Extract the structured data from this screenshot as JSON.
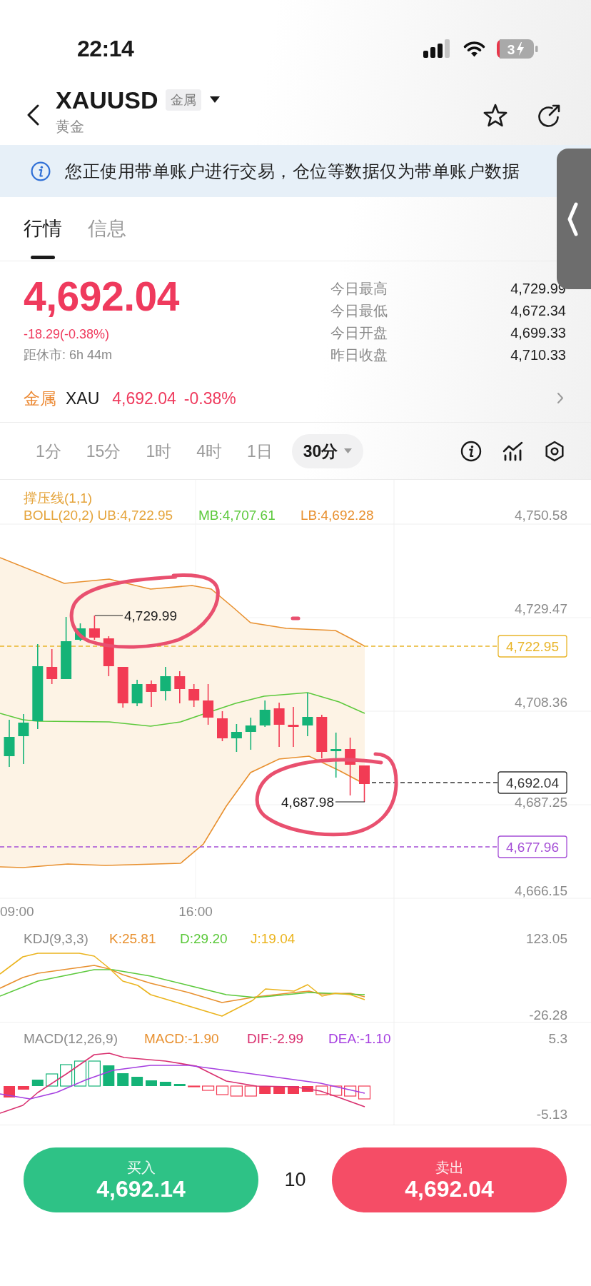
{
  "status_bar": {
    "time": "22:14",
    "battery": "3"
  },
  "header": {
    "symbol": "XAUUSD",
    "tag": "金属",
    "name": "黄金"
  },
  "notice": {
    "text": "您正使用带单账户进行交易，仓位等数据仅为带单账户数据"
  },
  "tabs": [
    {
      "label": "行情",
      "selected": true
    },
    {
      "label": "信息",
      "selected": false
    }
  ],
  "quote": {
    "price": "4,692.04",
    "change": "-18.29(-0.38%)",
    "countdown": "距休市: 6h 44m",
    "falling": true,
    "stats": [
      {
        "label": "今日最高",
        "value": "4,729.99"
      },
      {
        "label": "今日最低",
        "value": "4,672.34"
      },
      {
        "label": "今日开盘",
        "value": "4,699.33"
      },
      {
        "label": "昨日收盘",
        "value": "4,710.33"
      }
    ]
  },
  "market": {
    "category": "金属",
    "symbol": "XAU",
    "price": "4,692.04",
    "change": "-0.38%",
    "falling": true
  },
  "periods": [
    {
      "label": "1分",
      "selected": false,
      "dropdown": false
    },
    {
      "label": "15分",
      "selected": false,
      "dropdown": false
    },
    {
      "label": "1时",
      "selected": false,
      "dropdown": false
    },
    {
      "label": "4时",
      "selected": false,
      "dropdown": false
    },
    {
      "label": "1日",
      "selected": false,
      "dropdown": false
    },
    {
      "label": "30分",
      "selected": true,
      "dropdown": true
    }
  ],
  "main_chart": {
    "title": "撑压线(1,1)",
    "legend": [
      {
        "label": "BOLL(20,2) UB:4,722.95",
        "color": "#e5a43b"
      },
      {
        "label": "MB:4,707.61",
        "color": "#5cc93c"
      },
      {
        "label": "LB:4,692.28",
        "color": "#e8902f"
      }
    ],
    "y_axis": [
      "4,750.58",
      "4,729.47",
      "4,708.36",
      "4,687.25",
      "4,666.15"
    ],
    "x_axis": [
      "09:00",
      "16:00"
    ],
    "high": "4,729.99",
    "low": "4,687.98",
    "price_lines": [
      {
        "label": "4,722.95",
        "color": "#e9b52a"
      },
      {
        "label": "4,692.04",
        "color": "#333333"
      },
      {
        "label": "4,677.96",
        "color": "#a54fd6"
      }
    ]
  },
  "kdj": {
    "title": "KDJ(9,3,3)",
    "legend": [
      {
        "label": "K:25.81",
        "color": "#e8902f"
      },
      {
        "label": "D:29.20",
        "color": "#5cc93c"
      },
      {
        "label": "J:19.04",
        "color": "#ebb41e"
      }
    ],
    "y_axis": [
      "123.05",
      "-26.28"
    ]
  },
  "macd": {
    "title": "MACD(12,26,9)",
    "legend": [
      {
        "label": "MACD:-1.90",
        "color": "#e8902f"
      },
      {
        "label": "DIF:-2.99",
        "color": "#d9306f"
      },
      {
        "label": "DEA:-1.10",
        "color": "#a53fe0"
      }
    ],
    "y_axis": [
      "5.3",
      "-5.13"
    ]
  },
  "trade": {
    "buy": {
      "label": "买入",
      "price": "4,692.14"
    },
    "quantity": "10",
    "sell": {
      "label": "卖出",
      "price": "4,692.04"
    }
  }
}
